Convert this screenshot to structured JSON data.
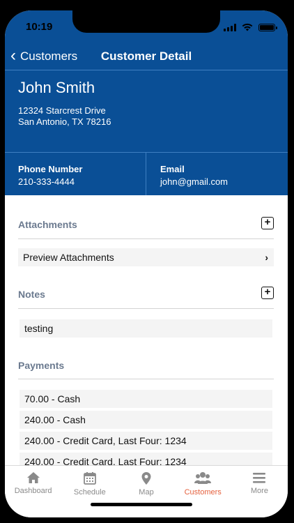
{
  "status": {
    "time": "10:19"
  },
  "nav": {
    "back_label": "Customers",
    "title": "Customer Detail"
  },
  "customer": {
    "name": "John Smith",
    "address_line1": "12324 Starcrest Drive",
    "address_line2": "San Antonio, TX 78216",
    "phone_label": "Phone Number",
    "phone": "210-333-4444",
    "email_label": "Email",
    "email": "john@gmail.com"
  },
  "attachments": {
    "title": "Attachments",
    "preview_label": "Preview Attachments"
  },
  "notes": {
    "title": "Notes",
    "items": [
      "testing"
    ]
  },
  "payments": {
    "title": "Payments",
    "items": [
      "70.00 - Cash",
      "240.00 - Cash",
      "240.00 - Credit Card, Last Four: 1234",
      "240.00 - Credit Card, Last Four: 1234"
    ]
  },
  "tabs": [
    {
      "label": "Dashboard",
      "icon": "home-icon"
    },
    {
      "label": "Schedule",
      "icon": "calendar-icon"
    },
    {
      "label": "Map",
      "icon": "map-pin-icon"
    },
    {
      "label": "Customers",
      "icon": "users-icon"
    },
    {
      "label": "More",
      "icon": "menu-icon"
    }
  ],
  "colors": {
    "header_blue": "#0a4f96",
    "active_tab": "#e5603d"
  }
}
